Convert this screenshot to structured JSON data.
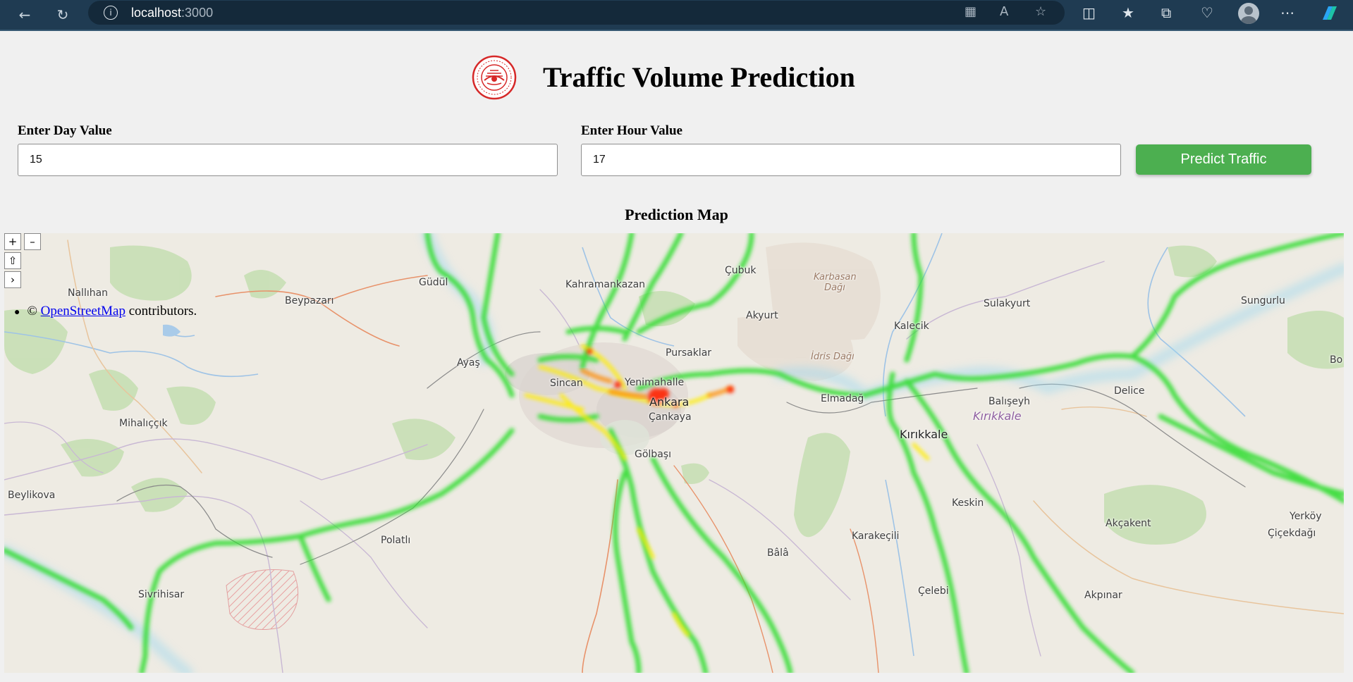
{
  "browser": {
    "url_host": "localhost",
    "url_port": ":3000"
  },
  "header": {
    "title": "Traffic Volume Prediction"
  },
  "form": {
    "day_label": "Enter Day Value",
    "day_value": "15",
    "hour_label": "Enter Hour Value",
    "hour_value": "17",
    "predict_label": "Predict Traffic"
  },
  "map": {
    "title": "Prediction Map",
    "zoom_in": "+",
    "zoom_out": "–",
    "control_home": "⇧",
    "control_expand": "›",
    "attribution_prefix": "© ",
    "attribution_link": "OpenStreetMap",
    "attribution_suffix": " contributors.",
    "places": [
      {
        "name": "Nallıhan",
        "kind": "town"
      },
      {
        "name": "Güdül",
        "kind": "town"
      },
      {
        "name": "Kahramankazan",
        "kind": "town"
      },
      {
        "name": "Çubuk",
        "kind": "town"
      },
      {
        "name": "Karbasan Dağı",
        "kind": "terrain"
      },
      {
        "name": "Beypazarı",
        "kind": "town"
      },
      {
        "name": "Akyurt",
        "kind": "town"
      },
      {
        "name": "Sulakyurt",
        "kind": "town"
      },
      {
        "name": "Sungurlu",
        "kind": "town"
      },
      {
        "name": "Kalecik",
        "kind": "town"
      },
      {
        "name": "Ayaş",
        "kind": "town"
      },
      {
        "name": "Pursaklar",
        "kind": "town"
      },
      {
        "name": "İdris Dağı",
        "kind": "terrain"
      },
      {
        "name": "Bo",
        "kind": "town"
      },
      {
        "name": "Sincan",
        "kind": "town"
      },
      {
        "name": "Yenimahalle",
        "kind": "town"
      },
      {
        "name": "Ankara",
        "kind": "city"
      },
      {
        "name": "Çankaya",
        "kind": "town"
      },
      {
        "name": "Elmadağ",
        "kind": "town"
      },
      {
        "name": "Balışeyh",
        "kind": "town"
      },
      {
        "name": "Delice",
        "kind": "town"
      },
      {
        "name": "Mihalıççık",
        "kind": "town"
      },
      {
        "name": "Kırıkkale",
        "kind": "province"
      },
      {
        "name": "Kırıkkale",
        "kind": "city"
      },
      {
        "name": "Gölbaşı",
        "kind": "town"
      },
      {
        "name": "Beylikova",
        "kind": "town"
      },
      {
        "name": "Keskin",
        "kind": "town"
      },
      {
        "name": "Yerköy",
        "kind": "town"
      },
      {
        "name": "Akçakent",
        "kind": "town"
      },
      {
        "name": "Çiçekdağı",
        "kind": "town"
      },
      {
        "name": "Polatlı",
        "kind": "town"
      },
      {
        "name": "Karakeçili",
        "kind": "town"
      },
      {
        "name": "Bâlâ",
        "kind": "town"
      },
      {
        "name": "Sivrihisar",
        "kind": "town"
      },
      {
        "name": "Çelebi",
        "kind": "town"
      },
      {
        "name": "Akpınar",
        "kind": "town"
      }
    ]
  },
  "colors": {
    "predict_button": "#4caf50",
    "heat_low": "#33dd33",
    "heat_mid": "#ffee00",
    "heat_high": "#ff1a00",
    "chrome": "#1f3b52"
  }
}
